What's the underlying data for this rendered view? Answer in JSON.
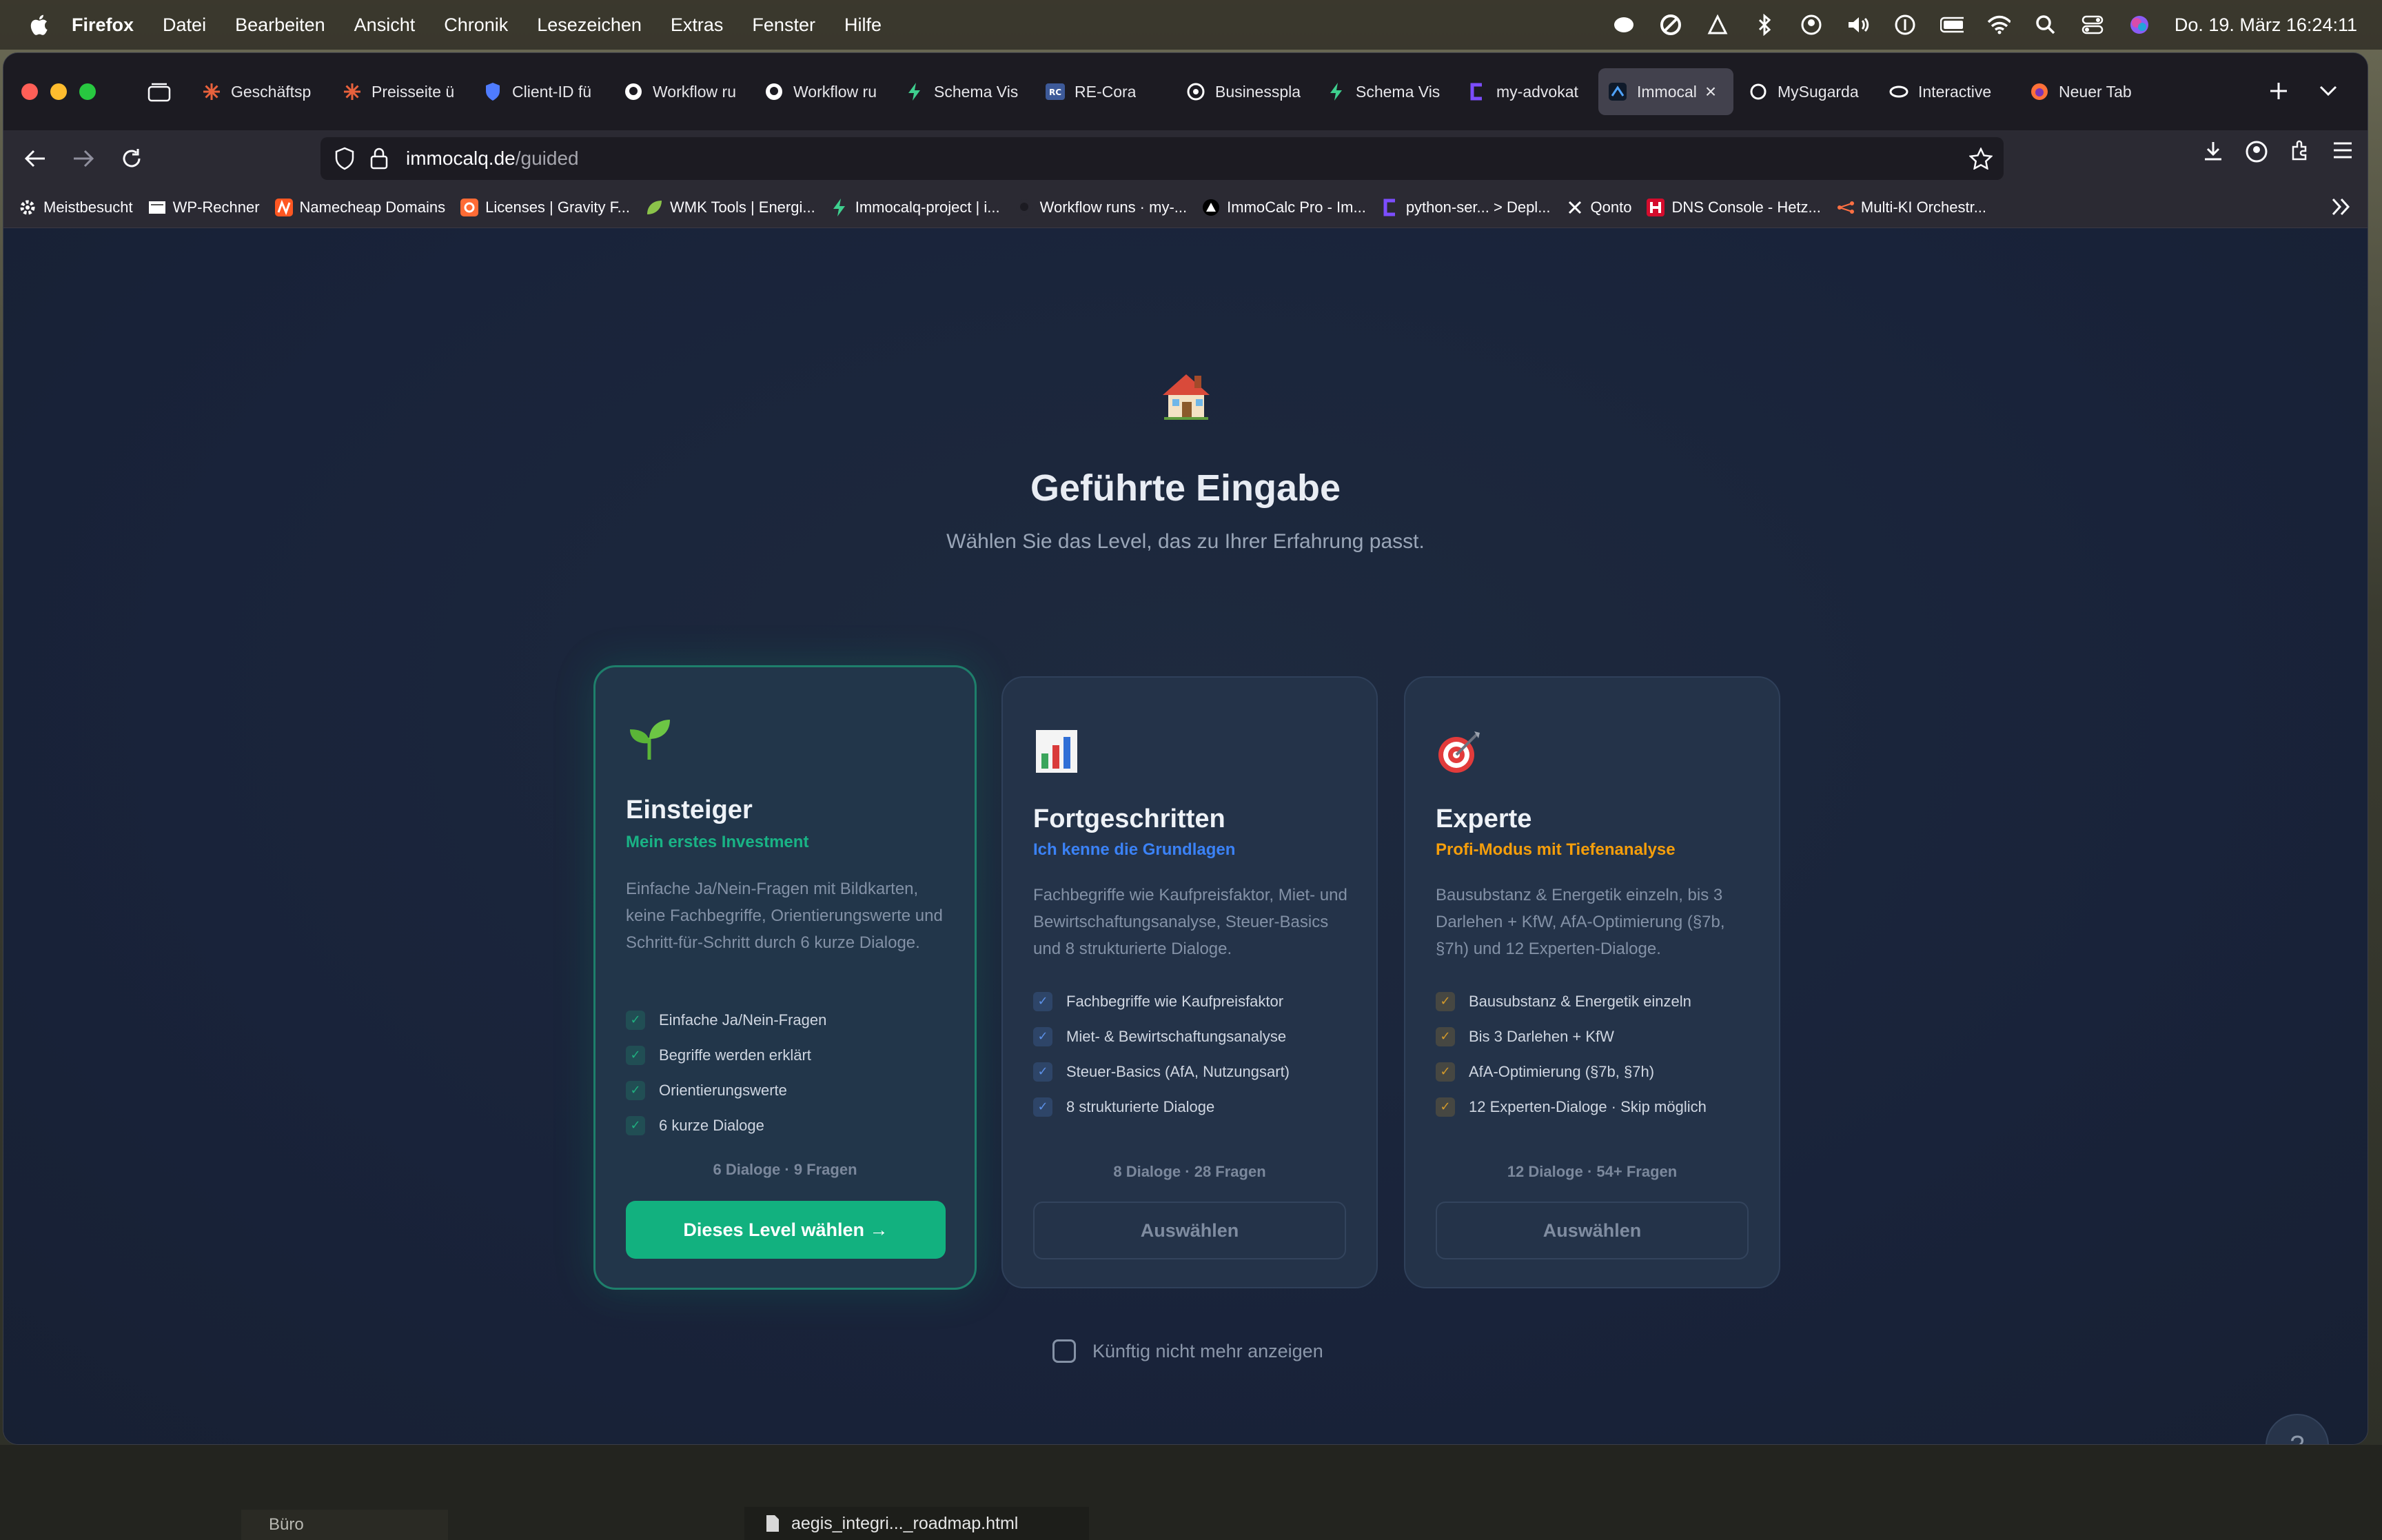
{
  "menubar": {
    "app": "Firefox",
    "items": [
      "Datei",
      "Bearbeiten",
      "Ansicht",
      "Chronik",
      "Lesezeichen",
      "Extras",
      "Fenster",
      "Hilfe"
    ],
    "clock": "Do. 19. März  16:24:11"
  },
  "tabs": [
    {
      "label": "Geschäftsp",
      "icon": "asterisk-icon",
      "color": "#e8613c"
    },
    {
      "label": "Preisseite ü",
      "icon": "asterisk-icon",
      "color": "#e8613c"
    },
    {
      "label": "Client-ID fü",
      "icon": "shield-icon",
      "color": "#4f7cff"
    },
    {
      "label": "Workflow ru",
      "icon": "github-icon",
      "color": "#ffffff"
    },
    {
      "label": "Workflow ru",
      "icon": "github-icon",
      "color": "#ffffff"
    },
    {
      "label": "Schema Vis",
      "icon": "bolt-icon",
      "color": "#3ecf8e"
    },
    {
      "label": "RE-Cora",
      "icon": "rc-icon",
      "color": "#3d5a99"
    },
    {
      "label": "Businesspla",
      "icon": "openai-icon",
      "color": "#ffffff"
    },
    {
      "label": "Schema Vis",
      "icon": "bolt-icon",
      "color": "#3ecf8e"
    },
    {
      "label": "my-advokat",
      "icon": "bracket-icon",
      "color": "#7c4dff"
    },
    {
      "label": "Immocal",
      "icon": "immocalq-icon",
      "color": "#4fa3ff",
      "active": true
    },
    {
      "label": "MySugarda",
      "icon": "sugar-icon",
      "color": "#ffffff"
    },
    {
      "label": "Interactive",
      "icon": "eye-icon",
      "color": "#ffffff"
    },
    {
      "label": "Neuer Tab",
      "icon": "firefox-icon",
      "color": "#ff7139"
    }
  ],
  "url": {
    "host": "immocalq.de",
    "path": "/guided"
  },
  "bookmarks": [
    {
      "label": "Meistbesucht",
      "icon": "gear-icon",
      "color": "#ffffff"
    },
    {
      "label": "WP-Rechner",
      "icon": "page-icon",
      "color": "#ffffff"
    },
    {
      "label": "Namecheap Domains",
      "icon": "namecheap-icon",
      "color": "#ff5722"
    },
    {
      "label": "Licenses | Gravity F...",
      "icon": "gravity-icon",
      "color": "#ff6b35"
    },
    {
      "label": "WMK Tools | Energi...",
      "icon": "leaf-icon",
      "color": "#8bc34a"
    },
    {
      "label": "Immocalq-project | i...",
      "icon": "bolt-icon",
      "color": "#3ecf8e"
    },
    {
      "label": "Workflow runs · my-...",
      "icon": "github-icon",
      "color": "#2b2a33"
    },
    {
      "label": "ImmoCalc Pro - Im...",
      "icon": "vercel-icon",
      "color": "#ffffff"
    },
    {
      "label": "python-ser... > Depl...",
      "icon": "bracket-icon",
      "color": "#7c4dff"
    },
    {
      "label": "Qonto",
      "icon": "x-icon",
      "color": "#ffffff"
    },
    {
      "label": "DNS Console - Hetz...",
      "icon": "hetzner-icon",
      "color": "#d50c2d"
    },
    {
      "label": "Multi-KI Orchestr...",
      "icon": "network-icon",
      "color": "#ff7043"
    }
  ],
  "page": {
    "title": "Geführte Eingabe",
    "subtitle": "Wählen Sie das Level, das zu Ihrer Erfahrung passt.",
    "dont_show": "Künftig nicht mehr anzeigen",
    "help": "?"
  },
  "cards": [
    {
      "icon": "seedling-icon",
      "title": "Einsteiger",
      "tagline": "Mein erstes Investment",
      "tag_color": "#19b385",
      "desc": "Einfache Ja/Nein-Fragen mit Bildkarten, keine Fachbegriffe, Orientierungswerte und Schritt-für-Schritt durch 6 kurze Dialoge.",
      "features": [
        "Einfache Ja/Nein-Fragen",
        "Begriffe werden erklärt",
        "Orientierungswerte",
        "6 kurze Dialoge"
      ],
      "check_color": "#1fae7f",
      "meta": "6 Dialoge · 9 Fragen",
      "button": "Dieses Level wählen →",
      "selected": true
    },
    {
      "icon": "bar-chart-icon",
      "title": "Fortgeschritten",
      "tagline": "Ich kenne die Grundlagen",
      "tag_color": "#3b82f6",
      "desc": "Fachbegriffe wie Kaufpreisfaktor, Miet- und Bewirtschaftungsanalyse, Steuer-Basics und 8 strukturierte Dialoge.",
      "features": [
        "Fachbegriffe wie Kaufpreisfaktor",
        "Miet- & Bewirtschaftungsanalyse",
        "Steuer-Basics (AfA, Nutzungsart)",
        "8 strukturierte Dialoge"
      ],
      "check_color": "#5b8fe6",
      "meta": "8 Dialoge · 28 Fragen",
      "button": "Auswählen",
      "selected": false
    },
    {
      "icon": "target-icon",
      "title": "Experte",
      "tagline": "Profi-Modus mit Tiefenanalyse",
      "tag_color": "#f59e0b",
      "desc": "Bausubstanz & Energetik einzeln, bis 3 Darlehen + KfW, AfA-Optimierung (§7b, §7h) und 12 Experten-Dialoge.",
      "features": [
        "Bausubstanz & Energetik einzeln",
        "Bis 3 Darlehen + KfW",
        "AfA-Optimierung (§7b, §7h)",
        "12 Experten-Dialoge · Skip möglich"
      ],
      "check_color": "#d39a2a",
      "meta": "12 Dialoge · 54+ Fragen",
      "button": "Auswählen",
      "selected": false
    }
  ],
  "taskbar": {
    "file": "aegis_integri..._roadmap.html",
    "folder": "Büro"
  }
}
